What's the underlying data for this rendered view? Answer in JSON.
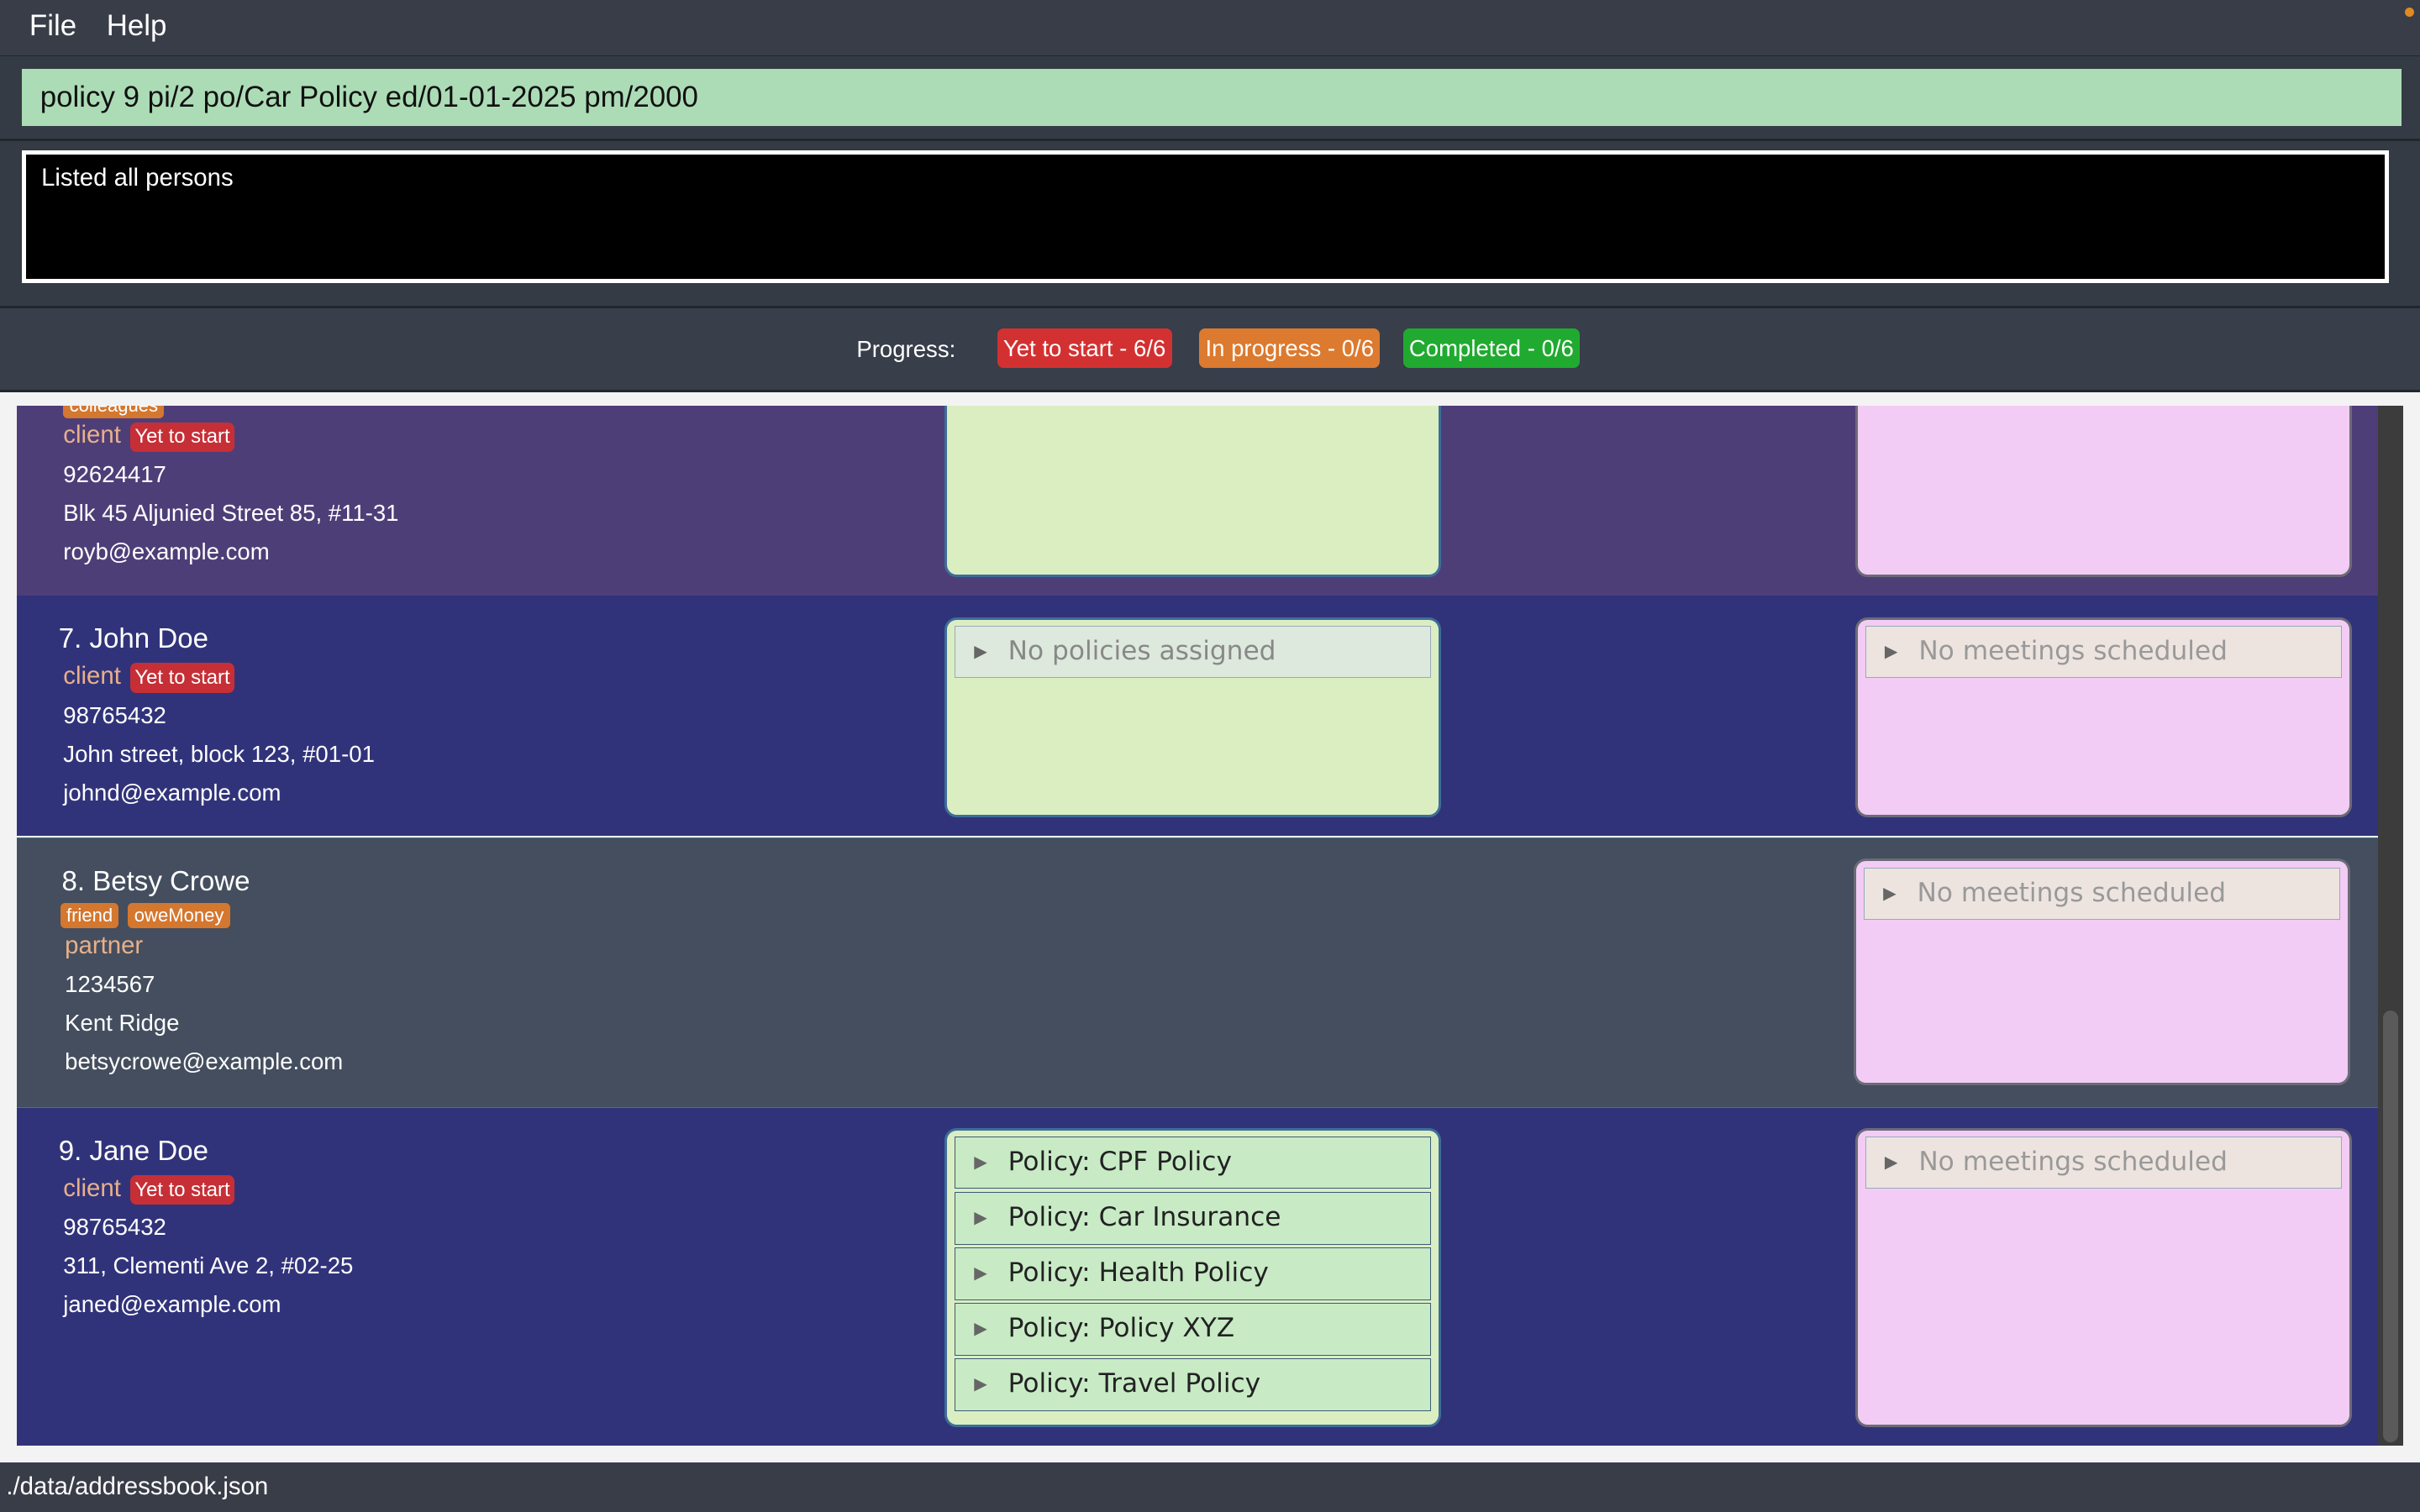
{
  "menu": {
    "file": "File",
    "help": "Help"
  },
  "command": {
    "value": "policy 9 pi/2 po/Car Policy ed/01-01-2025 pm/2000"
  },
  "result": {
    "text": "Listed all persons"
  },
  "progress": {
    "label": "Progress:",
    "yet": "Yet to start - 6/6",
    "inprog": "In progress - 0/6",
    "done": "Completed - 0/6",
    "colors": {
      "yet": "#d33131",
      "inprog": "#dc7a30",
      "done": "#20aa30"
    }
  },
  "persons": [
    {
      "tags": [
        "colleagues"
      ],
      "role": "client",
      "status": "Yet to start",
      "phone": "92624417",
      "address": "Blk 45 Aljunied Street 85, #11-31",
      "email": "royb@example.com",
      "bg": "#4e3e78"
    },
    {
      "name": "7.  John Doe",
      "role": "client",
      "status": "Yet to start",
      "phone": "98765432",
      "address": "John street, block 123, #01-01",
      "email": "johnd@example.com",
      "policies_empty": "No policies assigned",
      "meetings_empty": "No meetings scheduled",
      "bg": "#31337a"
    },
    {
      "name": "8.  Betsy Crowe",
      "tags": [
        "friend",
        "oweMoney"
      ],
      "role": "partner",
      "phone": "1234567",
      "address": "Kent Ridge",
      "email": "betsycrowe@example.com",
      "meetings_empty": "No meetings scheduled",
      "bg": "#444e5e"
    },
    {
      "name": "9.  Jane Doe",
      "role": "client",
      "status": "Yet to start",
      "phone": "98765432",
      "address": "311, Clementi Ave 2, #02-25",
      "email": "janed@example.com",
      "policies": [
        "Policy: CPF Policy",
        "Policy: Car Insurance",
        "Policy: Health Policy",
        "Policy: Policy XYZ",
        "Policy: Travel Policy"
      ],
      "meetings_empty": "No meetings scheduled",
      "bg": "#31337a"
    }
  ],
  "statusbar": {
    "path": "./data/addressbook.json"
  }
}
